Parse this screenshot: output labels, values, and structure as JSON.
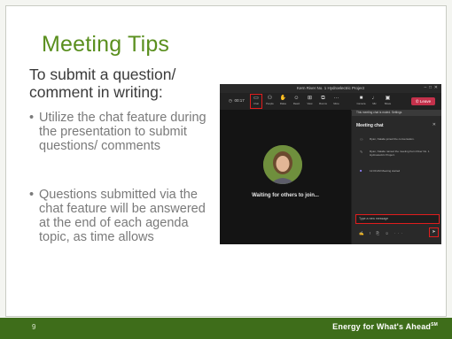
{
  "slide": {
    "title": "Meeting Tips",
    "subtitle": "To submit a question/ comment in writing:",
    "bullets": [
      "Utilize the chat feature during the presentation to submit questions/ comments",
      "Questions submitted via the chat feature will be answered at the end of each agenda topic, as time allows"
    ],
    "page_number": "9",
    "tagline": "Energy for What's Ahead",
    "tagline_mark": "SM",
    "accent_color": "#5a8f1e",
    "footer_color": "#3e6d1a"
  },
  "teams": {
    "window_title": "Kern River No. 1 Hydroelectric Project",
    "timer": "00:17",
    "toolbar": [
      {
        "label": "Chat",
        "icon": "chat-icon"
      },
      {
        "label": "People",
        "icon": "people-icon"
      },
      {
        "label": "Raise",
        "icon": "raise-hand-icon"
      },
      {
        "label": "React",
        "icon": "react-icon"
      },
      {
        "label": "View",
        "icon": "view-icon"
      },
      {
        "label": "Rooms",
        "icon": "rooms-icon"
      },
      {
        "label": "More",
        "icon": "more-icon"
      },
      {
        "label": "Camera",
        "icon": "camera-icon"
      },
      {
        "label": "Mic",
        "icon": "mic-icon"
      },
      {
        "label": "Share",
        "icon": "share-icon"
      }
    ],
    "leave_label": "Leave",
    "stage_status": "Waiting for others to join...",
    "chat": {
      "banner": "This meeting chat is muted. Settings",
      "header": "Meeting chat",
      "messages": [
        "Ryan, Natalie joined the conversation.",
        "Ryan, Natalie named the meeting Kern River No. 1 Hydroelectric Project.",
        "12:00 AM  Meeting started"
      ],
      "input_placeholder": "Type a new message"
    }
  }
}
